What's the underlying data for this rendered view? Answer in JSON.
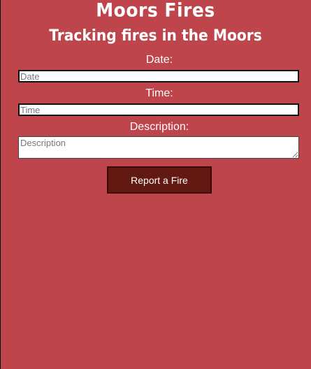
{
  "header": {
    "title": "Moors Fires",
    "subtitle": "Tracking fires in the Moors"
  },
  "form": {
    "date_label": "Date:",
    "date_placeholder": "Date",
    "time_label": "Time:",
    "time_placeholder": "Time",
    "description_label": "Description:",
    "description_placeholder": "Description",
    "submit_label": "Report a Fire"
  },
  "colors": {
    "background": "#bd454b",
    "button": "#621912",
    "text": "#ffffff"
  }
}
